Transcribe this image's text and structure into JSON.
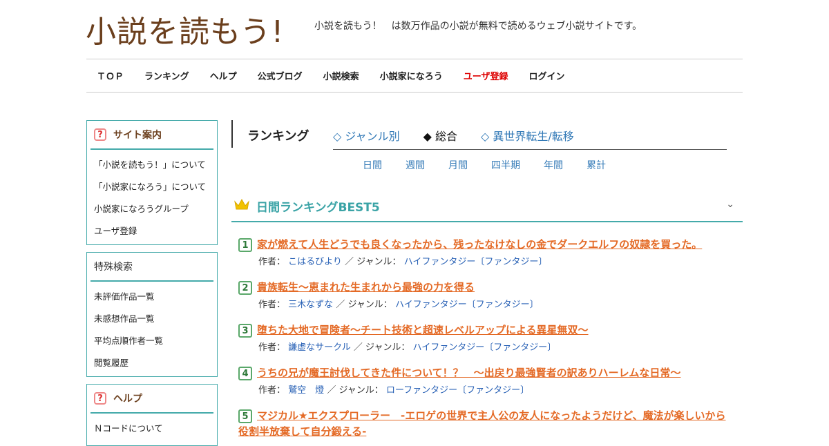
{
  "header": {
    "logo_text": "小説を読もう!",
    "tagline": "小説を読もう！　は数万作品の小説が無料で読めるウェブ小説サイトです。"
  },
  "nav": [
    {
      "label": "ＴＯＰ"
    },
    {
      "label": "ランキング"
    },
    {
      "label": "ヘルプ"
    },
    {
      "label": "公式ブログ"
    },
    {
      "label": "小説検索"
    },
    {
      "label": "小説家になろう"
    },
    {
      "label": "ユーザ登録",
      "color": "#dd0000"
    },
    {
      "label": "ログイン"
    }
  ],
  "sidebar": {
    "site_guide": {
      "title": "サイト案内",
      "icon": "question-icon",
      "items": [
        "「小説を読もう！」について",
        "「小説家になろう」について",
        "小説家になろうグループ",
        "ユーザ登録"
      ]
    },
    "special_search": {
      "title": "特殊検索",
      "items": [
        "未評価作品一覧",
        "未感想作品一覧",
        "平均点順作者一覧",
        "閲覧履歴"
      ]
    },
    "help": {
      "title": "ヘルプ",
      "icon": "question-icon",
      "items": [
        "Ｎコードについて"
      ]
    }
  },
  "ranking": {
    "title": "ランキング",
    "tabs": [
      "◇ ジャンル別",
      "◆ 総合",
      "◇ 異世界転生/転移"
    ],
    "active_tab": "◆ 総合",
    "periods": [
      "日間",
      "週間",
      "月間",
      "四半期",
      "年間",
      "累計"
    ]
  },
  "best5": {
    "title": "日間ランキングBEST5",
    "author_label": "作者：",
    "genre_label": "／ ジャンル：",
    "items": [
      {
        "rank": "1",
        "title": "家が燃えて人生どうでも良くなったから、残ったなけなしの金でダークエルフの奴隷を買った。",
        "author": "こはるびより",
        "genre": "ハイファンタジー〔ファンタジー〕"
      },
      {
        "rank": "2",
        "title": "貴族転生～恵まれた生まれから最強の力を得る",
        "author": "三木なずな",
        "genre": "ハイファンタジー〔ファンタジー〕"
      },
      {
        "rank": "3",
        "title": "堕ちた大地で冒険者〜チート技術と超速レベルアップによる異星無双〜",
        "author": "謙虚なサークル",
        "genre": "ハイファンタジー〔ファンタジー〕"
      },
      {
        "rank": "4",
        "title": "うちの兄が魔王討伐してきた件について！？　～出戻り最強賢者の訳ありハーレムな日常～",
        "author": "鷲空　燈",
        "genre": "ローファンタジー〔ファンタジー〕"
      },
      {
        "rank": "5",
        "title": "マジカル★エクスプローラー　-エロゲの世界で主人公の友人になったようだけど、魔法が楽しいから役割半放棄して自分鍛える-"
      }
    ]
  },
  "colors": {
    "accent": "#44aaaa",
    "title_orange": "#e46a26",
    "link_blue": "#2760b5",
    "logo_brown": "#6b3f1d"
  }
}
